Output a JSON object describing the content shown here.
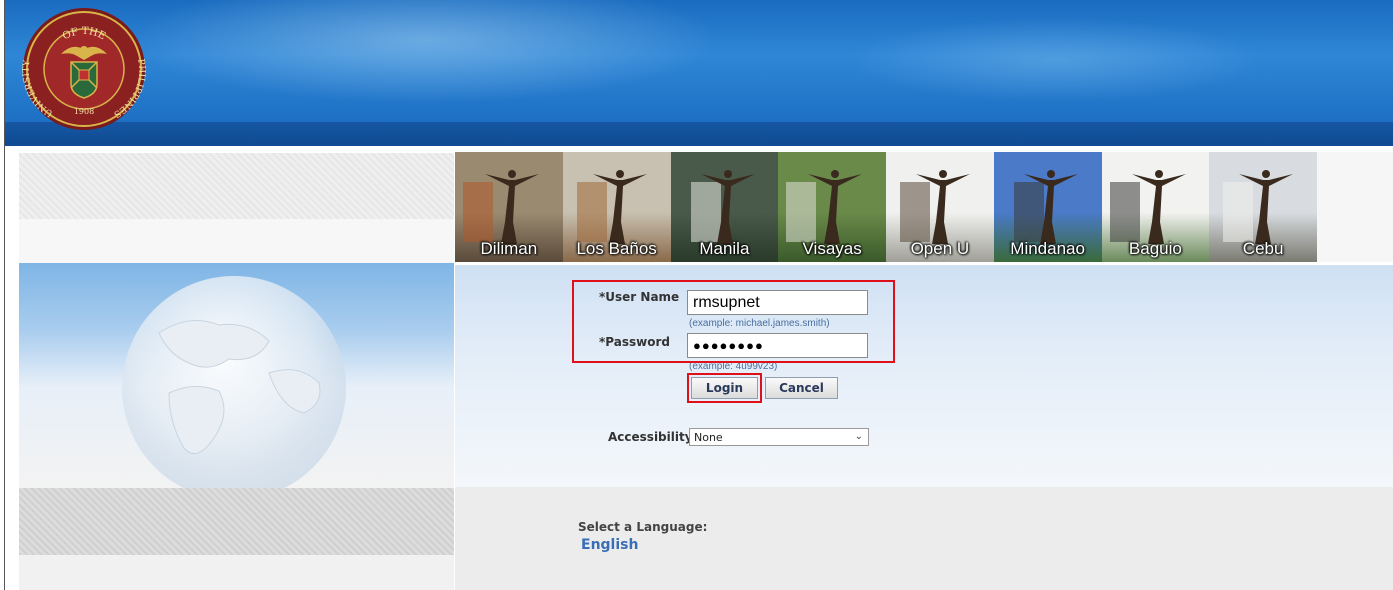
{
  "header": {
    "seal": {
      "top_text": "OF THE",
      "left_text": "UNIVERSITY",
      "right_text": "PHILIPPINES",
      "year": "1908"
    }
  },
  "campuses": [
    {
      "name": "Diliman",
      "sky": "#9a8a70",
      "ground": "#5a4a3a",
      "accent": "#b05a2a"
    },
    {
      "name": "Los Baños",
      "sky": "#c8c0b0",
      "ground": "#8a6a4a",
      "accent": "#a06a3a"
    },
    {
      "name": "Manila",
      "sky": "#4a5a4a",
      "ground": "#2a3a2a",
      "accent": "#e8e8e0"
    },
    {
      "name": "Visayas",
      "sky": "#6a8a4a",
      "ground": "#3a5a2a",
      "accent": "#e0e0d8"
    },
    {
      "name": "Open U",
      "sky": "#f0f0ee",
      "ground": "#a0a098",
      "accent": "#5a4a3a"
    },
    {
      "name": "Mindanao",
      "sky": "#4a7ac8",
      "ground": "#3a6a3a",
      "accent": "#3a3a3a"
    },
    {
      "name": "Baguio",
      "sky": "#f2f2f0",
      "ground": "#6a8a5a",
      "accent": "#3a3a3a"
    },
    {
      "name": "Cebu",
      "sky": "#d8dce0",
      "ground": "#7a7a70",
      "accent": "#f0f0ec"
    }
  ],
  "login": {
    "username_label": "*User Name",
    "username_value": "rmsupnet",
    "username_hint": "(example: michael.james.smith)",
    "password_label": "*Password",
    "password_value": "●●●●●●●●",
    "password_hint": "(example: 4u99v23)",
    "login_button": "Login",
    "cancel_button": "Cancel",
    "accessibility_label": "Accessibility",
    "accessibility_selected": "None"
  },
  "language": {
    "label": "Select a Language:",
    "option": "English"
  },
  "colors": {
    "highlight": "#e0101a",
    "banner": "#2f86d6",
    "link": "#3a6fb5"
  }
}
